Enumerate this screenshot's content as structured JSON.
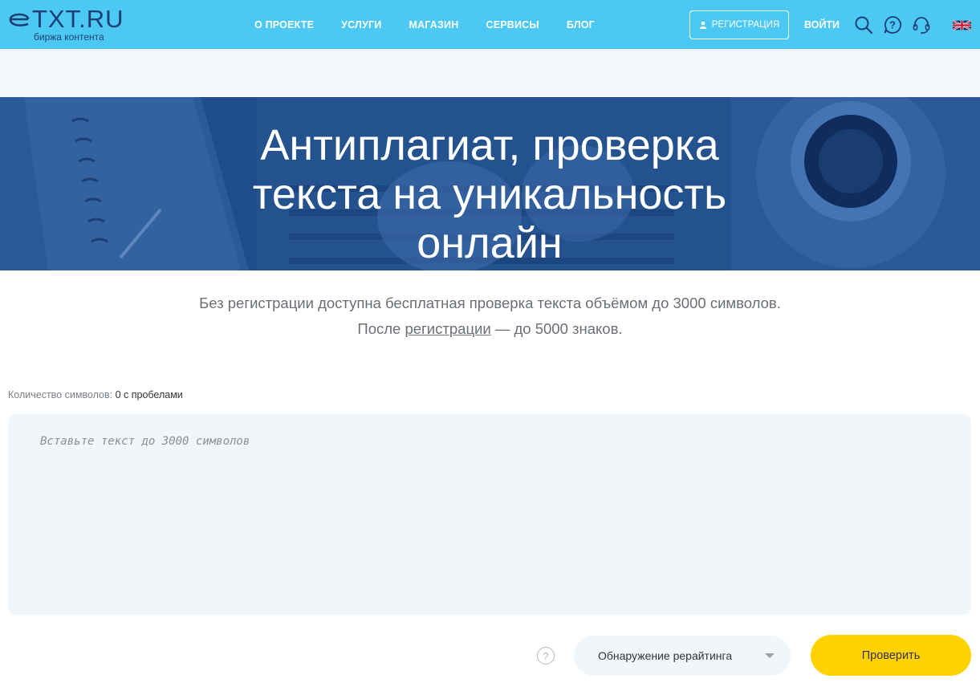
{
  "header": {
    "logo_main": "TXT.RU",
    "logo_sub": "биржа контента",
    "nav": [
      {
        "label": "О ПРОЕКТЕ"
      },
      {
        "label": "УСЛУГИ"
      },
      {
        "label": "МАГАЗИН"
      },
      {
        "label": "СЕРВИСЫ"
      },
      {
        "label": "БЛОГ"
      }
    ],
    "register_label": "РЕГИСТРАЦИЯ",
    "login_label": "ВОЙТИ"
  },
  "hero": {
    "title_line1": "Антиплагиат, проверка",
    "title_line2": "текста на уникальность",
    "title_line3": "онлайн"
  },
  "subtitle": {
    "line1": "Без регистрации доступна бесплатная проверка текста объёмом до 3000 символов.",
    "line2_prefix": "После",
    "line2_link": "регистрации",
    "line2_suffix": "— до 5000 знаков."
  },
  "counter": {
    "label": "Количество символов:",
    "value": "0 с пробелами"
  },
  "editor": {
    "placeholder": "Вставьте текст до 3000 символов",
    "value": ""
  },
  "controls": {
    "help_symbol": "?",
    "mode_selected": "Обнаружение рерайтинга",
    "check_label": "Проверить"
  },
  "colors": {
    "header_bg": "#4cc8f4",
    "hero_bg": "#1f4d8c",
    "button_yellow": "#ffd200",
    "input_bg": "#f0f6fa"
  }
}
